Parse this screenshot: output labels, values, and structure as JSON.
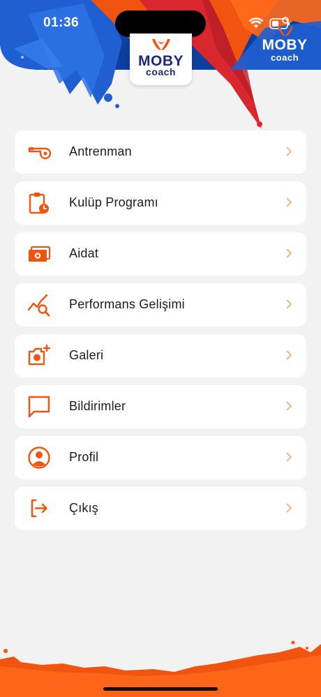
{
  "status_bar": {
    "time": "01:36"
  },
  "brand": {
    "name": "MOBY",
    "tagline": "coach",
    "colors": {
      "primary_orange": "#f0540f",
      "navy": "#1f2a7a",
      "blue": "#1f5fd1",
      "red": "#d9272e"
    }
  },
  "menu": {
    "items": [
      {
        "id": "antrenman",
        "label": "Antrenman",
        "icon": "whistle-icon"
      },
      {
        "id": "kulup-programi",
        "label": "Kulüp Programı",
        "icon": "clipboard-clock-icon"
      },
      {
        "id": "aidat",
        "label": "Aidat",
        "icon": "cash-icon"
      },
      {
        "id": "performans",
        "label": "Performans Gelişimi",
        "icon": "chart-search-icon"
      },
      {
        "id": "galeri",
        "label": "Galeri",
        "icon": "camera-plus-icon"
      },
      {
        "id": "bildirimler",
        "label": "Bildirimler",
        "icon": "message-icon"
      },
      {
        "id": "profil",
        "label": "Profil",
        "icon": "user-circle-icon"
      },
      {
        "id": "cikis",
        "label": "Çıkış",
        "icon": "logout-icon"
      }
    ]
  }
}
